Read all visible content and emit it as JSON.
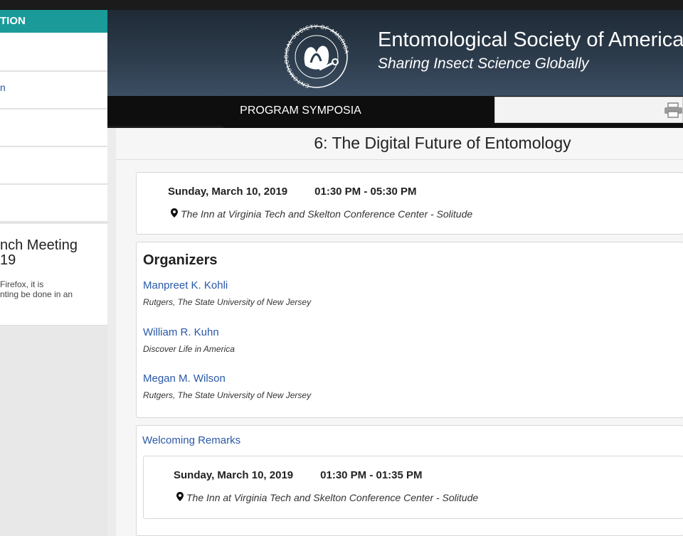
{
  "sidebar": {
    "header": "TION",
    "items": [
      {
        "label": ""
      },
      {
        "label": "n"
      },
      {
        "label": ""
      },
      {
        "label": ""
      },
      {
        "label": ""
      }
    ],
    "card": {
      "title_line1": "nch Meeting",
      "title_line2": "19",
      "note_line1": "Firefox, it is",
      "note_line2": "nting be done in an"
    }
  },
  "banner": {
    "org_name": "Entomological Society of America",
    "tagline": "Sharing Insect Science Globally",
    "logo_ring_text": "ENTOMOLOGICAL SOCIETY OF AMERICA"
  },
  "nav": {
    "tab_label": "PROGRAM SYMPOSIA",
    "print_icon": "printer-icon"
  },
  "page": {
    "title": "6: The Digital Future of Entomology"
  },
  "session": {
    "date": "Sunday, March 10, 2019",
    "time": "01:30 PM - 05:30 PM",
    "location": "The Inn at Virginia Tech and Skelton Conference Center - Solitude"
  },
  "organizers": {
    "heading": "Organizers",
    "people": [
      {
        "name": "Manpreet K. Kohli",
        "affiliation": "Rutgers, The State University of New Jersey"
      },
      {
        "name": "William R. Kuhn",
        "affiliation": "Discover Life in America"
      },
      {
        "name": "Megan M. Wilson",
        "affiliation": "Rutgers, The State University of New Jersey"
      }
    ]
  },
  "remarks": {
    "link": "Welcoming Remarks",
    "date": "Sunday, March 10, 2019",
    "time": "01:30 PM - 01:35 PM",
    "location": "The Inn at Virginia Tech and Skelton Conference Center - Solitude"
  },
  "colors": {
    "accent_teal": "#1a9b99",
    "link_blue": "#2a58a8",
    "banner_dark": "#2d3c4c"
  }
}
